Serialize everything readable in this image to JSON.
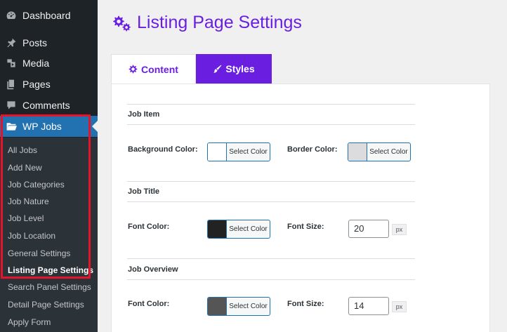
{
  "sidebar": {
    "menu": [
      {
        "label": "Dashboard",
        "icon": "dashboard-icon"
      },
      {
        "label": "Posts",
        "icon": "pushpin-icon"
      },
      {
        "label": "Media",
        "icon": "media-icon"
      },
      {
        "label": "Pages",
        "icon": "pages-icon"
      },
      {
        "label": "Comments",
        "icon": "comment-icon"
      },
      {
        "label": "WP Jobs",
        "icon": "folder-icon",
        "active": true
      }
    ],
    "submenu": [
      "All Jobs",
      "Add New",
      "Job Categories",
      "Job Nature",
      "Job Level",
      "Job Location",
      "General Settings",
      "Listing Page Settings",
      "Search Panel Settings",
      "Detail Page Settings",
      "Apply Form"
    ],
    "current_submenu": "Listing Page Settings"
  },
  "main": {
    "title": "Listing Page Settings",
    "title_icon": "gears-icon",
    "tabs": [
      {
        "label": "Content",
        "icon": "gear-icon",
        "active": false
      },
      {
        "label": "Styles",
        "icon": "paintbrush-icon",
        "active": true
      }
    ],
    "sections": [
      {
        "title": "Job Item",
        "fields": [
          {
            "label": "Background Color:",
            "button_text": "Select Color",
            "swatch": "#ffffff"
          },
          {
            "label": "Border Color:",
            "button_text": "Select Color",
            "swatch": "#dcdcde"
          }
        ]
      },
      {
        "title": "Job Title",
        "fields": [
          {
            "label": "Font Color:",
            "button_text": "Select Color",
            "swatch": "#222222"
          },
          {
            "label": "Font Size:",
            "value": "20",
            "unit": "px"
          }
        ]
      },
      {
        "title": "Job Overview",
        "fields": [
          {
            "label": "Font Color:",
            "button_text": "Select Color",
            "swatch": "#555555"
          },
          {
            "label": "Font Size:",
            "value": "14",
            "unit": "px"
          }
        ]
      }
    ]
  },
  "colors": {
    "accent": "#6a1ee0",
    "sidebar_bg": "#1d2327",
    "submenu_bg": "#2c3338",
    "active_menu": "#2271b1",
    "highlight": "#e5142a"
  }
}
